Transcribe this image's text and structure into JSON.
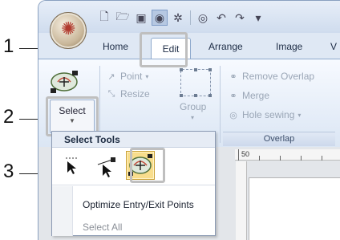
{
  "titlebar": {
    "qat_icons": [
      "new-icon",
      "open-icon",
      "save-icon",
      "record-icon",
      "settings-icon",
      "circle-tool-icon",
      "undo-icon",
      "redo-icon",
      "customize-icon"
    ]
  },
  "tabs": {
    "home": "Home",
    "edit": "Edit",
    "arrange": "Arrange",
    "image": "Image",
    "more": "V"
  },
  "ribbon": {
    "select_label": "Select",
    "point_label": "Point",
    "resize_label": "Resize",
    "group_label": "Group",
    "remove_overlap_label": "Remove Overlap",
    "merge_label": "Merge",
    "hole_sewing_label": "Hole sewing",
    "overlap_group_label": "Overlap"
  },
  "ruler": {
    "mark_50": "50"
  },
  "menu": {
    "title": "Select Tools",
    "optimize_label": "Optimize Entry/Exit Points",
    "select_all_label": "Select All"
  },
  "callouts": [
    "1",
    "2",
    "3"
  ],
  "colors": {
    "active_tool_bg": "#f8dd8c",
    "highlight_border": "#bfbfbf"
  }
}
